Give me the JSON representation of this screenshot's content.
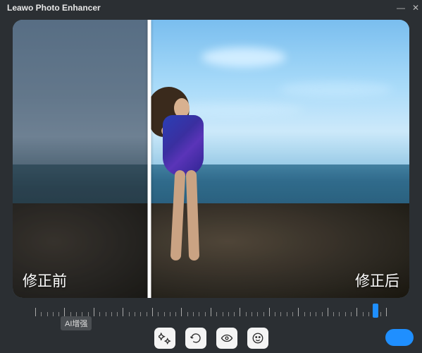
{
  "app": {
    "title": "Leawo Photo Enhancer"
  },
  "compare": {
    "before_label": "修正前",
    "after_label": "修正后",
    "divider_position_pct": 34.5
  },
  "slider": {
    "tooltip": "AI增强",
    "value_pct": 96
  },
  "toolbar": {
    "buttons": [
      {
        "name": "ai-enhance",
        "icon": "sparkle"
      },
      {
        "name": "auto-adjust",
        "icon": "swirl"
      },
      {
        "name": "eye-enhance",
        "icon": "eye"
      },
      {
        "name": "face-retouch",
        "icon": "face"
      }
    ]
  },
  "colors": {
    "accent": "#1f8fff",
    "background": "#2b2f33"
  }
}
